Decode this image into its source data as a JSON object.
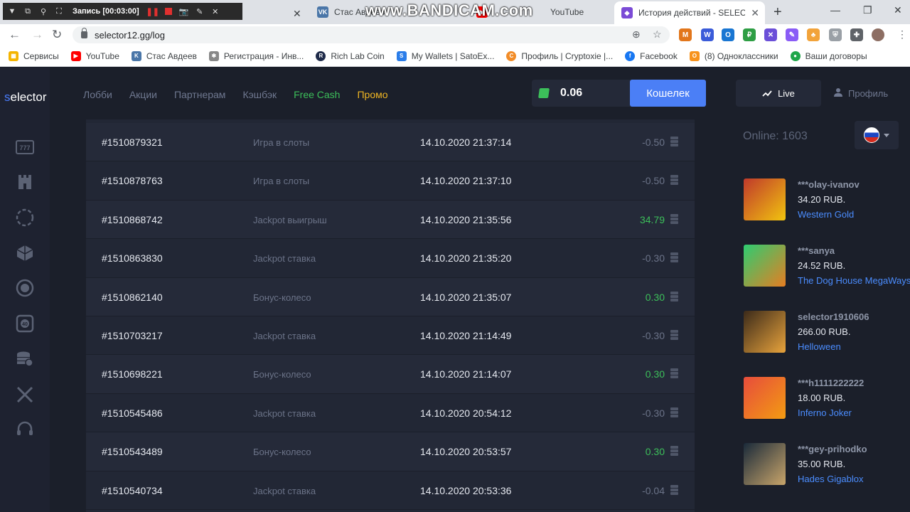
{
  "recorder": {
    "label": "Запись [00:03:00]",
    "watermark": "www.BANDICAM.com"
  },
  "browser": {
    "tabs": [
      {
        "title": "Стас Авдеев",
        "active": false
      },
      {
        "title": "YouTube",
        "active": false
      },
      {
        "title": "История действий - SELECTOR",
        "active": true
      }
    ],
    "url": "selector12.gg/log",
    "bookmarks": [
      {
        "label": "Сервисы",
        "icon": "apps-grid-icon",
        "color": "#f4b400"
      },
      {
        "label": "YouTube",
        "icon": "youtube-icon",
        "color": "#ff0000"
      },
      {
        "label": "Стас Авдеев",
        "icon": "vk-icon",
        "color": "#4a76a8"
      },
      {
        "label": "Регистрация - Инв...",
        "icon": "pinwheel-icon",
        "color": "#888888"
      },
      {
        "label": "Rich Lab Coin",
        "icon": "richlab-icon",
        "color": "#1f2b4a"
      },
      {
        "label": "My Wallets | SatoEx...",
        "icon": "satoex-icon",
        "color": "#2b7de9"
      },
      {
        "label": "Профиль | Cryptoxie |...",
        "icon": "cryptoxie-icon",
        "color": "#f28c28"
      },
      {
        "label": "Facebook",
        "icon": "facebook-icon",
        "color": "#1877f2"
      },
      {
        "label": "(8) Одноклассники",
        "icon": "ok-icon",
        "color": "#f7931e"
      },
      {
        "label": "Ваши договоры",
        "icon": "contracts-icon",
        "color": "#1fa64a"
      }
    ]
  },
  "site": {
    "logo_prefix": "s",
    "logo_rest": "elector",
    "menu": [
      {
        "label": "Лобби",
        "style": "normal"
      },
      {
        "label": "Акции",
        "style": "normal"
      },
      {
        "label": "Партнерам",
        "style": "normal"
      },
      {
        "label": "Кэшбэк",
        "style": "normal"
      },
      {
        "label": "Free Cash",
        "style": "free"
      },
      {
        "label": "Промо",
        "style": "promo"
      }
    ],
    "balance": "0.06",
    "wallet_button": "Кошелек",
    "live_tab": "Live",
    "profile_tab": "Профиль",
    "online": "Online: 1603",
    "transactions": [
      {
        "id": "#1510879321",
        "type": "Игра в слоты",
        "date": "14.10.2020 21:37:14",
        "amount": "-0.50",
        "positive": false
      },
      {
        "id": "#1510878763",
        "type": "Игра в слоты",
        "date": "14.10.2020 21:37:10",
        "amount": "-0.50",
        "positive": false
      },
      {
        "id": "#1510868742",
        "type": "Jackpot выигрыш",
        "date": "14.10.2020 21:35:56",
        "amount": "34.79",
        "positive": true
      },
      {
        "id": "#1510863830",
        "type": "Jackpot ставка",
        "date": "14.10.2020 21:35:20",
        "amount": "-0.30",
        "positive": false
      },
      {
        "id": "#1510862140",
        "type": "Бонус-колесо",
        "date": "14.10.2020 21:35:07",
        "amount": "0.30",
        "positive": true
      },
      {
        "id": "#1510703217",
        "type": "Jackpot ставка",
        "date": "14.10.2020 21:14:49",
        "amount": "-0.30",
        "positive": false
      },
      {
        "id": "#1510698221",
        "type": "Бонус-колесо",
        "date": "14.10.2020 21:14:07",
        "amount": "0.30",
        "positive": true
      },
      {
        "id": "#1510545486",
        "type": "Jackpot ставка",
        "date": "14.10.2020 20:54:12",
        "amount": "-0.30",
        "positive": false
      },
      {
        "id": "#1510543489",
        "type": "Бонус-колесо",
        "date": "14.10.2020 20:53:57",
        "amount": "0.30",
        "positive": true
      },
      {
        "id": "#1510540734",
        "type": "Jackpot ставка",
        "date": "14.10.2020 20:53:36",
        "amount": "-0.04",
        "positive": false
      }
    ],
    "live_wins": [
      {
        "user": "***olay-ivanov",
        "sum": "34.20 RUB.",
        "game": "Western Gold",
        "colors": [
          "#c0392b",
          "#f1c40f"
        ]
      },
      {
        "user": "***sanya",
        "sum": "24.52 RUB.",
        "game": "The Dog House MegaWays",
        "colors": [
          "#2ecc71",
          "#e67e22"
        ]
      },
      {
        "user": "selector1910606",
        "sum": "266.00 RUB.",
        "game": "Helloween",
        "colors": [
          "#3b2a1a",
          "#e8a33c"
        ]
      },
      {
        "user": "***h1111222222",
        "sum": "18.00 RUB.",
        "game": "Inferno Joker",
        "colors": [
          "#e74c3c",
          "#f39c12"
        ]
      },
      {
        "user": "***gey-prihodko",
        "sum": "35.00 RUB.",
        "game": "Hades Gigablox",
        "colors": [
          "#1a2a3a",
          "#c9a56a"
        ]
      }
    ]
  }
}
